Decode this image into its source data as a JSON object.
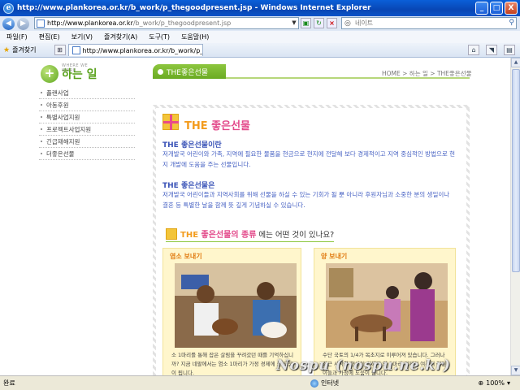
{
  "window": {
    "title": "http://www.plankorea.or.kr/b_work/p_thegoodpresent.jsp - Windows Internet Explorer",
    "minimize": "_",
    "maximize": "□",
    "close": "X"
  },
  "address_bar": {
    "url_domain": "http://www.plankorea.or.kr",
    "url_path": "/b_work/p_thegoodpresent.jsp",
    "search_placeholder": "네이트"
  },
  "menu": [
    "파일(F)",
    "편집(E)",
    "보기(V)",
    "즐겨찾기(A)",
    "도구(T)",
    "도움말(H)"
  ],
  "favorites_bar": {
    "favorites_label": "즐겨찾기",
    "tab_title": "http://www.plankorea.or.kr/b_work/p_thegoo..."
  },
  "page": {
    "logo_small": "WHERE WE WORK",
    "logo_text": "하는 일",
    "sidebar": [
      "플랜사업",
      "아동후원",
      "특별사업지원",
      "프로젝트사업지원",
      "긴급재해지원",
      "더좋은선물"
    ],
    "section_tab": "THE좋은선물",
    "breadcrumb": "HOME > 하는 일 > THE좋은선물",
    "heading_the": "THE",
    "heading_rest": " 좋은선물",
    "sub1": "THE 좋은선물이란",
    "para1": "저개발국 어린이와 가족, 지역에 필요한 물품을 현금으로 현지에 전달해 보다 경제적이고 지역 중심적인 방법으로 현지 개발에 도움을 주는 선물입니다.",
    "sub2": "THE 좋은선물은",
    "para2": "저개발국 어린이들과 지역사회를 위해 선물을 하실 수 있는 기회가 될 뿐 아니라 후원자님과 소중한 분의 생일이나 결혼 등 특별한 날을 함께 뜻 깊게 기념하실 수 있습니다.",
    "question_title_the": "THE",
    "question_title_rest": " 좋은선물의 종류",
    "question_suffix": "에는 어떤 것이 있나요?",
    "cards": [
      {
        "label": "염소 보내기",
        "caption": "소 1마리를 통해 잡은 살림을 꾸려갔던 때를 기억하십니까? 지금 네팔에서는 염소 1마리가 가정 경제에 큰 도움이 됩니다."
      },
      {
        "label": "양 보내기",
        "caption": "수단 국토의 1/4가 목초지로 이루어져 있습니다. 그러나 최근 사막화 현상이 심해져 양 1마리 경제적 여건이 어린이들과 가정에 도움이 됩니다."
      }
    ]
  },
  "status": {
    "text": "완료",
    "zone": "인터넷",
    "zoom": "100%"
  },
  "watermark": "Nospu (nospu.ne.kr)"
}
